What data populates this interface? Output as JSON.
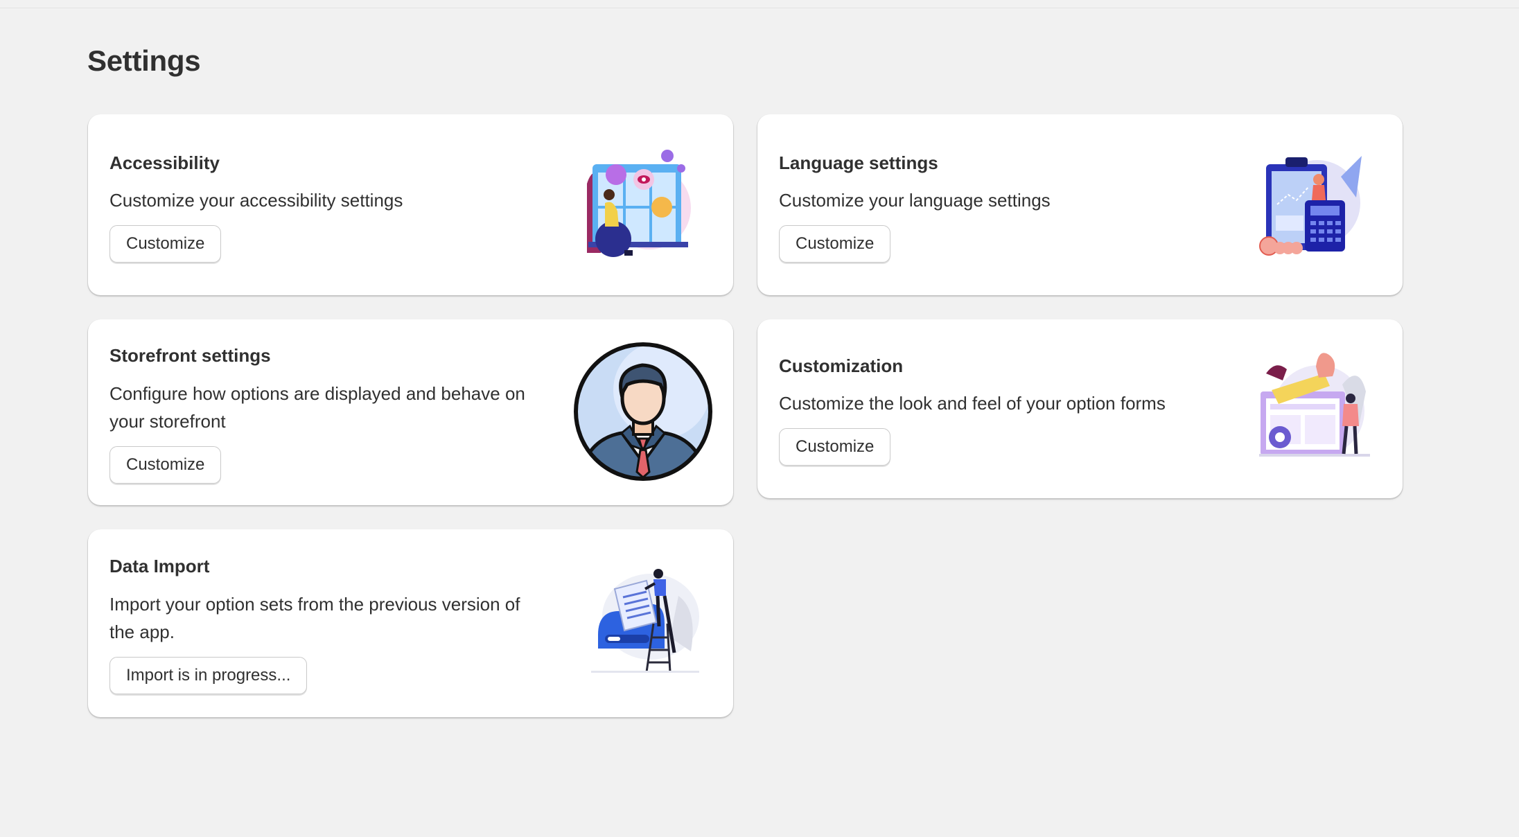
{
  "page": {
    "title": "Settings"
  },
  "cards": [
    {
      "title": "Accessibility",
      "description": "Customize your accessibility settings",
      "button": "Customize",
      "illustration": "accessibility-illustration"
    },
    {
      "title": "Language settings",
      "description": "Customize your language settings",
      "button": "Customize",
      "illustration": "language-illustration"
    },
    {
      "title": "Storefront settings",
      "description": "Configure how options are displayed and behave on your storefront",
      "button": "Customize",
      "illustration": "storefront-avatar-illustration"
    },
    {
      "title": "Customization",
      "description": "Customize the look and feel of your option forms",
      "button": "Customize",
      "illustration": "customization-illustration"
    },
    {
      "title": "Data Import",
      "description": "Import your option sets from the previous version of the app.",
      "button": "Import is in progress...",
      "illustration": "data-import-illustration"
    }
  ],
  "colors": {
    "background": "#f1f1f1",
    "card": "#ffffff",
    "text": "#303030",
    "button_border": "#c9c9c9"
  }
}
